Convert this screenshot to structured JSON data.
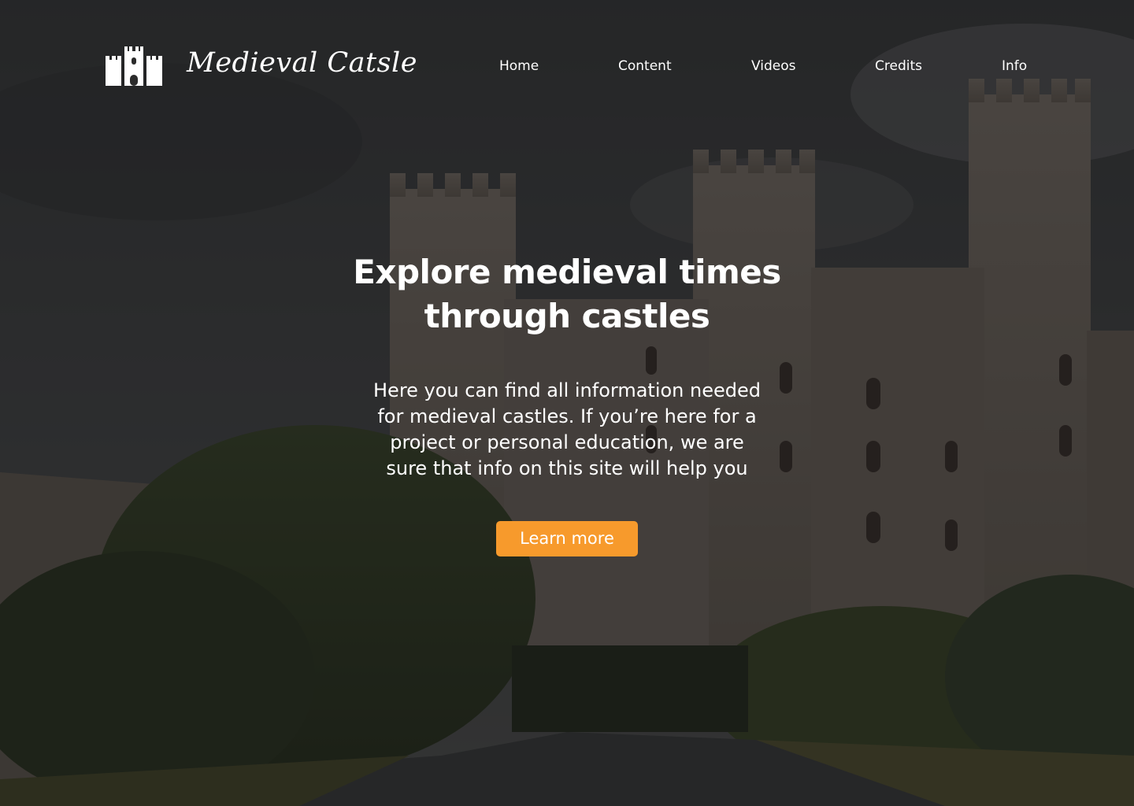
{
  "header": {
    "brand": "Medieval Catsle",
    "logo_icon": "castle-icon"
  },
  "nav": {
    "items": [
      {
        "label": "Home"
      },
      {
        "label": "Content"
      },
      {
        "label": "Videos"
      },
      {
        "label": "Credits"
      },
      {
        "label": "Info"
      }
    ]
  },
  "hero": {
    "headline_lines": [
      "Explore medieval times",
      "through castles"
    ],
    "lead_lines": [
      "Here you can find all information needed",
      "for medieval castles. If you’re here for a",
      "project or personal education, we are",
      "sure that info on this site will help you"
    ],
    "cta_label": "Learn more"
  },
  "colors": {
    "accent": "#f79a2c",
    "text": "#ffffff",
    "overlay": "#141414"
  }
}
